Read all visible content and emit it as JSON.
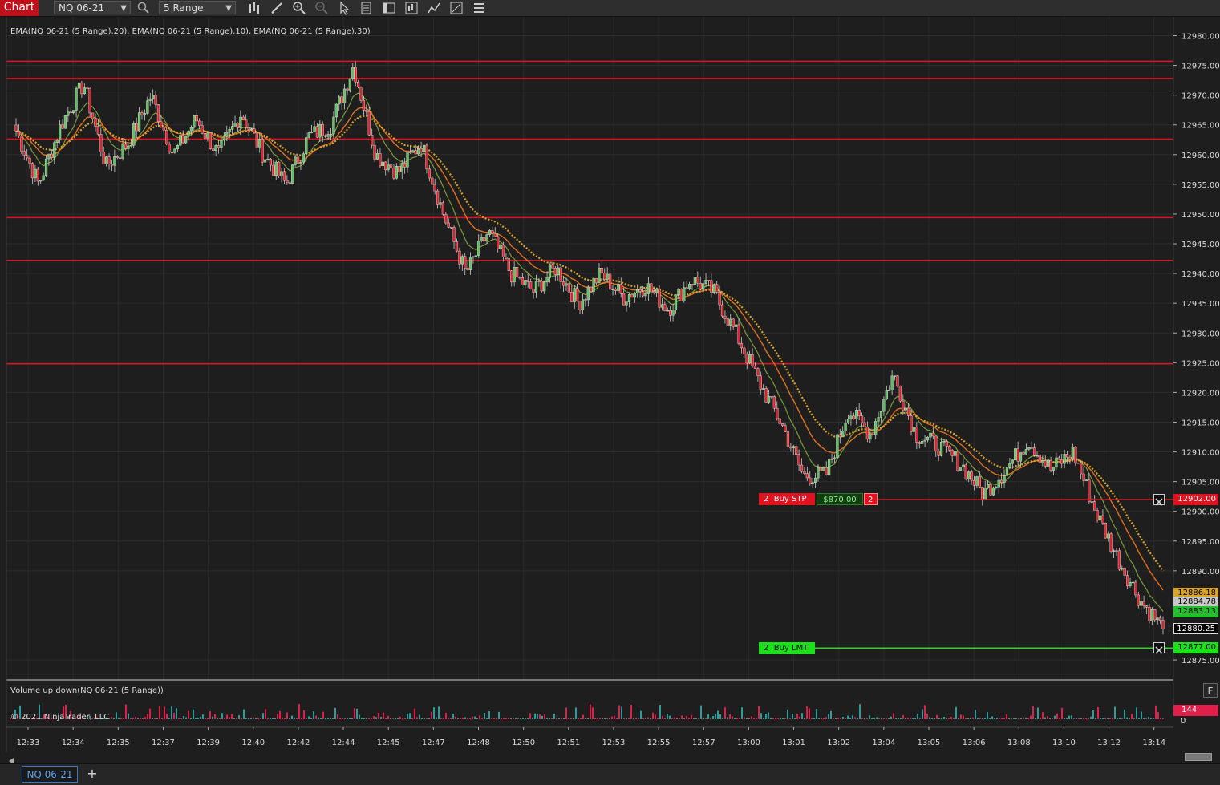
{
  "toolbar": {
    "chart_label": "Chart",
    "instrument": "NQ 06-21",
    "bar_type": "5 Range",
    "icons": [
      "search-icon",
      "bars-type-icon",
      "drawing-tool-icon",
      "zoom-in-icon",
      "zoom-out-icon",
      "pointer-icon",
      "data-box-icon",
      "template-icon",
      "strategy-icon",
      "indicator-icon",
      "properties-icon",
      "list-icon"
    ]
  },
  "indicators": {
    "price_panel_label": "EMA(NQ 06-21 (5 Range),20), EMA(NQ 06-21 (5 Range),10), EMA(NQ 06-21 (5 Range),30)",
    "volume_panel_label": "Volume up down(NQ 06-21 (5 Range))",
    "copyright": "© 2021 NinjaTrader, LLC",
    "volume_last": "144",
    "volume_zero": "0",
    "f_button": "F"
  },
  "price_axis": {
    "ticks": [
      "12980.00",
      "12975.00",
      "12970.00",
      "12965.00",
      "12960.00",
      "12955.00",
      "12950.00",
      "12945.00",
      "12940.00",
      "12935.00",
      "12930.00",
      "12925.00",
      "12920.00",
      "12915.00",
      "12910.00",
      "12905.00",
      "12900.00",
      "12895.00",
      "12890.00",
      "12875.00"
    ],
    "markers": [
      {
        "label": "12902.00",
        "price": 12902.0,
        "bg": "#e3101e",
        "fg": "#ffffff"
      },
      {
        "label": "12886.18",
        "price": 12886.18,
        "bg": "#d9a528",
        "fg": "#000000"
      },
      {
        "label": "12884.78",
        "price": 12884.78,
        "bg": "#c7c7c7",
        "fg": "#000000"
      },
      {
        "label": "12883.13",
        "price": 12883.13,
        "bg": "#22c02a",
        "fg": "#000000"
      },
      {
        "label": "12880.25",
        "price": 12880.25,
        "bg": "#000000",
        "fg": "#ffffff"
      },
      {
        "label": "12877.00",
        "price": 12877.0,
        "bg": "#19e219",
        "fg": "#000000"
      }
    ]
  },
  "time_axis": {
    "labels": [
      "12:33",
      "12:34",
      "12:35",
      "12:37",
      "12:39",
      "12:40",
      "12:42",
      "12:44",
      "12:45",
      "12:47",
      "12:48",
      "12:50",
      "12:51",
      "12:53",
      "12:55",
      "12:57",
      "13:00",
      "13:01",
      "13:02",
      "13:04",
      "13:05",
      "13:06",
      "13:08",
      "13:10",
      "13:12",
      "13:14"
    ]
  },
  "horizontal_lines": [
    12975.7,
    12972.8,
    12962.6,
    12949.4,
    12942.2,
    12924.8
  ],
  "orders": {
    "buy_stop": {
      "qty": "2",
      "label": "Buy STP",
      "pnl": "$870.00",
      "count": "2",
      "price": 12902.0
    },
    "buy_limit": {
      "qty": "2",
      "label": "Buy LMT",
      "price": 12877.0
    }
  },
  "chart_data": {
    "type": "candlestick",
    "instrument": "NQ 06-21",
    "bar_type": "5 Range",
    "ylim": [
      12872.5,
      12982.5
    ],
    "price_path": [
      {
        "time": "12:33",
        "price": 12964
      },
      {
        "time": "12:33",
        "price": 12955
      },
      {
        "time": "12:34",
        "price": 12965
      },
      {
        "time": "12:34",
        "price": 12972
      },
      {
        "time": "12:35",
        "price": 12958
      },
      {
        "time": "12:35",
        "price": 12962
      },
      {
        "time": "12:37",
        "price": 12970
      },
      {
        "time": "12:37",
        "price": 12960
      },
      {
        "time": "12:39",
        "price": 12966
      },
      {
        "time": "12:39",
        "price": 12960
      },
      {
        "time": "12:40",
        "price": 12967
      },
      {
        "time": "12:40",
        "price": 12960
      },
      {
        "time": "12:42",
        "price": 12955
      },
      {
        "time": "12:42",
        "price": 12963
      },
      {
        "time": "12:44",
        "price": 12965
      },
      {
        "time": "12:44",
        "price": 12975
      },
      {
        "time": "12:45",
        "price": 12960
      },
      {
        "time": "12:45",
        "price": 12957
      },
      {
        "time": "12:47",
        "price": 12962
      },
      {
        "time": "12:47",
        "price": 12950
      },
      {
        "time": "12:48",
        "price": 12940
      },
      {
        "time": "12:48",
        "price": 12947
      },
      {
        "time": "12:50",
        "price": 12940
      },
      {
        "time": "12:50",
        "price": 12937
      },
      {
        "time": "12:51",
        "price": 12941
      },
      {
        "time": "12:51",
        "price": 12935
      },
      {
        "time": "12:53",
        "price": 12940
      },
      {
        "time": "12:53",
        "price": 12936
      },
      {
        "time": "12:55",
        "price": 12938
      },
      {
        "time": "12:55",
        "price": 12934
      },
      {
        "time": "12:57",
        "price": 12939
      },
      {
        "time": "12:57",
        "price": 12937
      },
      {
        "time": "13:00",
        "price": 12930
      },
      {
        "time": "13:00",
        "price": 12922
      },
      {
        "time": "13:01",
        "price": 12915
      },
      {
        "time": "13:01",
        "price": 12906
      },
      {
        "time": "13:02",
        "price": 12906
      },
      {
        "time": "13:02",
        "price": 12917
      },
      {
        "time": "13:04",
        "price": 12913
      },
      {
        "time": "13:04",
        "price": 12923
      },
      {
        "time": "13:05",
        "price": 12913
      },
      {
        "time": "13:05",
        "price": 12911
      },
      {
        "time": "13:06",
        "price": 12908
      },
      {
        "time": "13:06",
        "price": 12903
      },
      {
        "time": "13:08",
        "price": 12907
      },
      {
        "time": "13:08",
        "price": 12912
      },
      {
        "time": "13:10",
        "price": 12907
      },
      {
        "time": "13:10",
        "price": 12910
      },
      {
        "time": "13:12",
        "price": 12900
      },
      {
        "time": "13:12",
        "price": 12892
      },
      {
        "time": "13:14",
        "price": 12885
      },
      {
        "time": "13:14",
        "price": 12880.25
      }
    ],
    "series": [
      {
        "name": "EMA(NQ 06-21 (5 Range),10)",
        "color": "#7a9a3a"
      },
      {
        "name": "EMA(NQ 06-21 (5 Range),20)",
        "color": "#e07020"
      },
      {
        "name": "EMA(NQ 06-21 (5 Range),30)",
        "color": "#d9a528"
      }
    ],
    "up_color": "#5fbf5f",
    "down_color": "#e0202a",
    "volume_up_color": "#2a9d9d",
    "volume_down_color": "#e0204a"
  }
}
